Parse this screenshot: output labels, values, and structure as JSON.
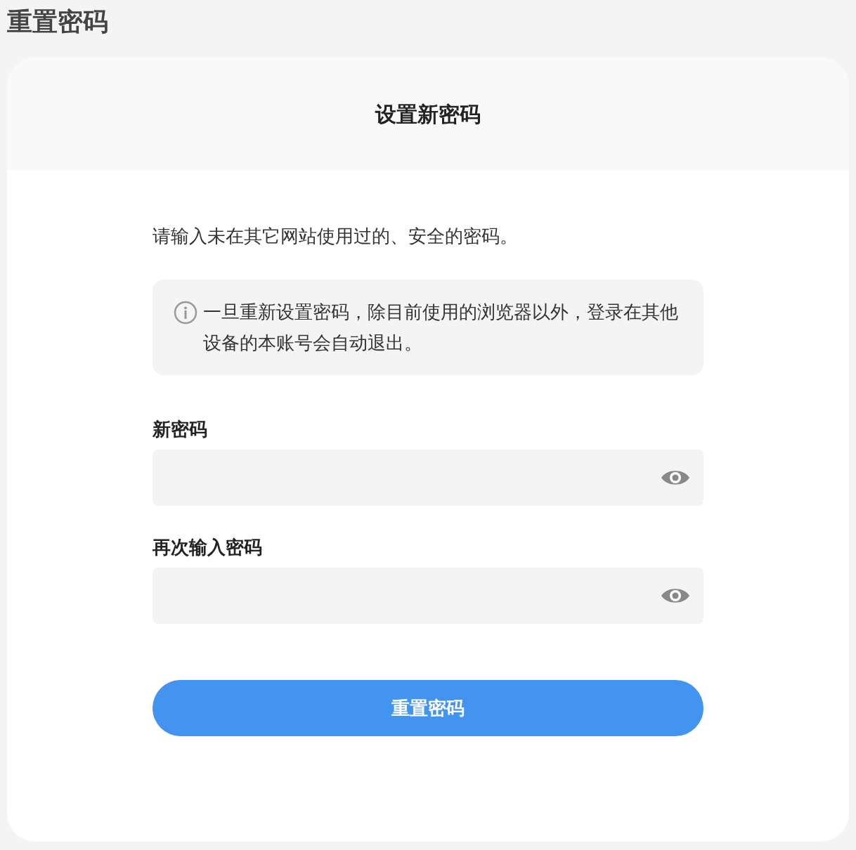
{
  "page_title": "重置密码",
  "card": {
    "title": "设置新密码",
    "intro": "请输入未在其它网站使用过的、安全的密码。",
    "notice": "一旦重新设置密码，除目前使用的浏览器以外，登录在其他设备的本账号会自动退出。",
    "fields": [
      {
        "label": "新密码"
      },
      {
        "label": "再次输入密码"
      }
    ],
    "button": "重置密码"
  }
}
